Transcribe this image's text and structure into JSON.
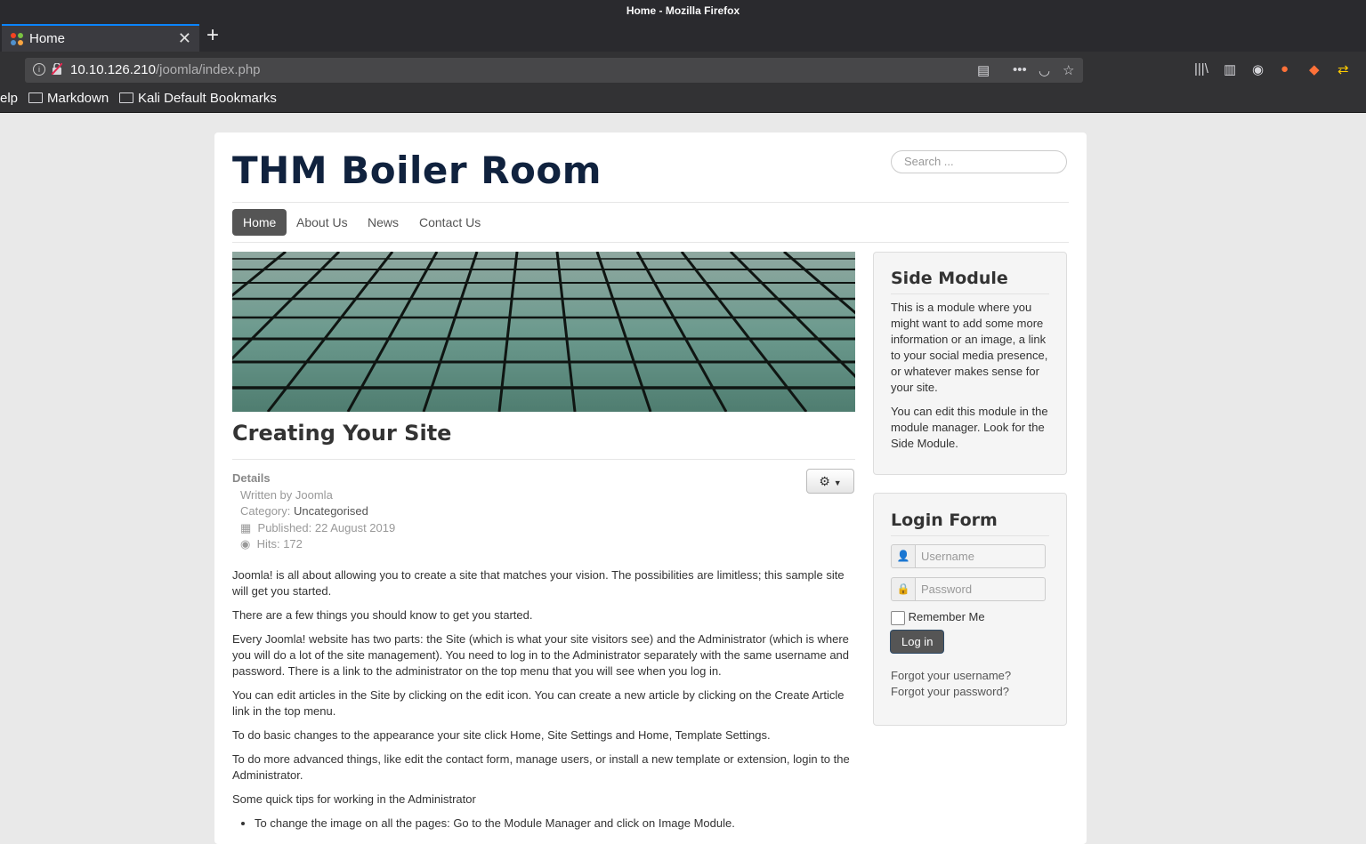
{
  "window": {
    "title": "Home - Mozilla Firefox"
  },
  "tab": {
    "title": "Home"
  },
  "url": {
    "host": "10.10.126.210",
    "path": "/joomla/index.php"
  },
  "bookmarks": {
    "partial_item": "elp",
    "items": [
      "Markdown",
      "Kali Default Bookmarks"
    ]
  },
  "site": {
    "title": "THM Boiler Room",
    "search_placeholder": "Search ...",
    "nav": [
      "Home",
      "About Us",
      "News",
      "Contact Us"
    ]
  },
  "article": {
    "title": "Creating Your Site",
    "details_label": "Details",
    "written_by": "Written by Joomla",
    "category_label": "Category:",
    "category": "Uncategorised",
    "published": "Published: 22 August 2019",
    "hits": "Hits: 172",
    "paragraphs": [
      "Joomla! is all about allowing you to create a site that matches your vision. The possibilities are limitless; this sample site will get you started.",
      "There are a few things you should know to get you started.",
      "Every Joomla! website has two parts: the Site (which is what your site visitors see) and the Administrator (which is where you will do a lot of the site management). You need to log in to the Administrator separately with the same username and password. There is a link to the administrator on the top menu that you will see when you log in.",
      "You can edit articles in the Site by clicking on the edit icon. You can create a new article by clicking on the Create Article link in the top menu.",
      "To do basic changes to the appearance your site click Home, Site Settings and Home, Template Settings.",
      "To do more advanced things, like edit the contact form, manage users, or install a new template or extension, login to the Administrator.",
      "Some quick tips for working in the Administrator"
    ],
    "tips": [
      "To change the image on all the pages: Go to the Module Manager and click on Image Module."
    ]
  },
  "side_module": {
    "title": "Side Module",
    "p1": "This is a module where you might want to add some more information or an image, a link to your social media presence, or whatever makes sense for your site.",
    "p2": "You can edit this module in the module manager. Look for the Side Module."
  },
  "login": {
    "title": "Login Form",
    "username_placeholder": "Username",
    "password_placeholder": "Password",
    "remember": "Remember Me",
    "button": "Log in",
    "forgot_username": "Forgot your username?",
    "forgot_password": "Forgot your password?"
  }
}
